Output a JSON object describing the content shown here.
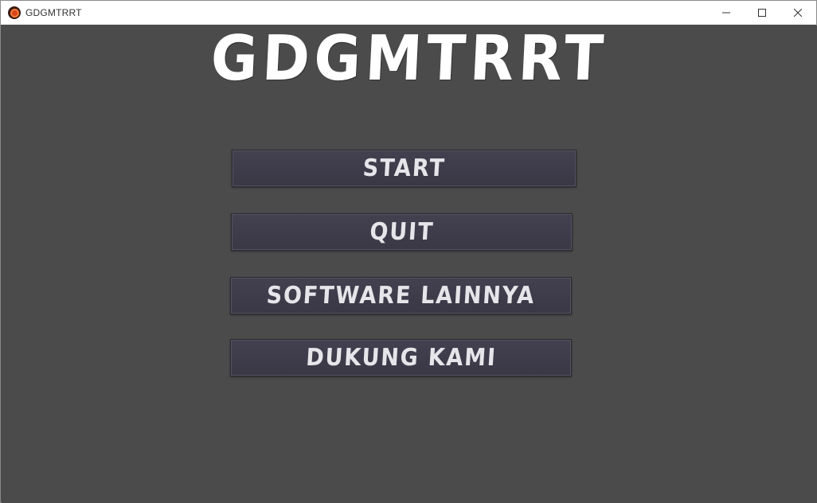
{
  "window": {
    "title": "GDGMTRRT"
  },
  "game": {
    "title": "GDGMTRRT",
    "menu": {
      "start": "START",
      "quit": "QUIT",
      "software": "SOFTWARE LAINNYA",
      "dukung": "DUKUNG KAMI"
    }
  },
  "colors": {
    "background": "#4b4b4b",
    "button": "#3d3b48",
    "text": "#e6e6ea",
    "title": "#ffffff"
  }
}
